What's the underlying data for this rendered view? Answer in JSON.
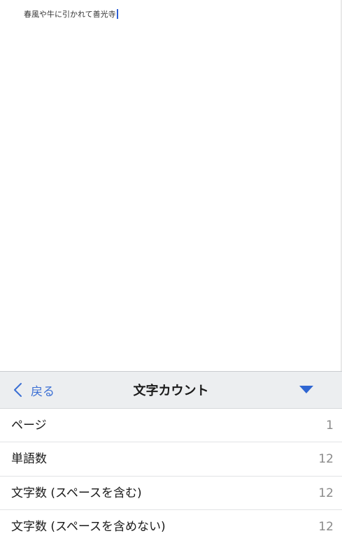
{
  "document": {
    "text": "春風や牛に引かれて善光寺"
  },
  "panel": {
    "back_label": "戻る",
    "title": "文字カウント",
    "rows": [
      {
        "label": "ページ",
        "value": "1"
      },
      {
        "label": "単語数",
        "value": "12"
      },
      {
        "label": "文字数 (スペースを含む)",
        "value": "12"
      },
      {
        "label": "文字数 (スペースを含めない)",
        "value": "12"
      }
    ]
  },
  "colors": {
    "accent": "#3b6fd4",
    "caret": "#2d5fd6",
    "header_bg": "#eceef0"
  },
  "icons": {
    "back": "chevron-left-icon",
    "collapse": "triangle-down-icon"
  }
}
